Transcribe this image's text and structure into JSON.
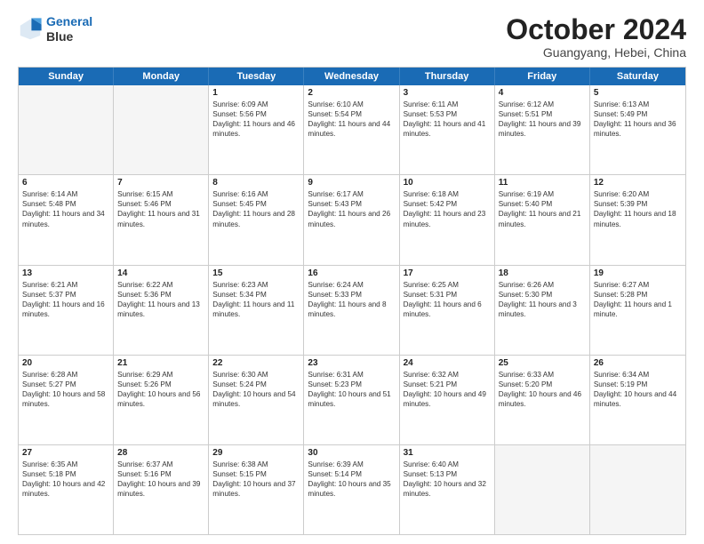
{
  "header": {
    "logo_line1": "General",
    "logo_line2": "Blue",
    "month": "October 2024",
    "location": "Guangyang, Hebei, China"
  },
  "weekdays": [
    "Sunday",
    "Monday",
    "Tuesday",
    "Wednesday",
    "Thursday",
    "Friday",
    "Saturday"
  ],
  "rows": [
    [
      {
        "day": "",
        "sunrise": "",
        "sunset": "",
        "daylight": ""
      },
      {
        "day": "",
        "sunrise": "",
        "sunset": "",
        "daylight": ""
      },
      {
        "day": "1",
        "sunrise": "Sunrise: 6:09 AM",
        "sunset": "Sunset: 5:56 PM",
        "daylight": "Daylight: 11 hours and 46 minutes."
      },
      {
        "day": "2",
        "sunrise": "Sunrise: 6:10 AM",
        "sunset": "Sunset: 5:54 PM",
        "daylight": "Daylight: 11 hours and 44 minutes."
      },
      {
        "day": "3",
        "sunrise": "Sunrise: 6:11 AM",
        "sunset": "Sunset: 5:53 PM",
        "daylight": "Daylight: 11 hours and 41 minutes."
      },
      {
        "day": "4",
        "sunrise": "Sunrise: 6:12 AM",
        "sunset": "Sunset: 5:51 PM",
        "daylight": "Daylight: 11 hours and 39 minutes."
      },
      {
        "day": "5",
        "sunrise": "Sunrise: 6:13 AM",
        "sunset": "Sunset: 5:49 PM",
        "daylight": "Daylight: 11 hours and 36 minutes."
      }
    ],
    [
      {
        "day": "6",
        "sunrise": "Sunrise: 6:14 AM",
        "sunset": "Sunset: 5:48 PM",
        "daylight": "Daylight: 11 hours and 34 minutes."
      },
      {
        "day": "7",
        "sunrise": "Sunrise: 6:15 AM",
        "sunset": "Sunset: 5:46 PM",
        "daylight": "Daylight: 11 hours and 31 minutes."
      },
      {
        "day": "8",
        "sunrise": "Sunrise: 6:16 AM",
        "sunset": "Sunset: 5:45 PM",
        "daylight": "Daylight: 11 hours and 28 minutes."
      },
      {
        "day": "9",
        "sunrise": "Sunrise: 6:17 AM",
        "sunset": "Sunset: 5:43 PM",
        "daylight": "Daylight: 11 hours and 26 minutes."
      },
      {
        "day": "10",
        "sunrise": "Sunrise: 6:18 AM",
        "sunset": "Sunset: 5:42 PM",
        "daylight": "Daylight: 11 hours and 23 minutes."
      },
      {
        "day": "11",
        "sunrise": "Sunrise: 6:19 AM",
        "sunset": "Sunset: 5:40 PM",
        "daylight": "Daylight: 11 hours and 21 minutes."
      },
      {
        "day": "12",
        "sunrise": "Sunrise: 6:20 AM",
        "sunset": "Sunset: 5:39 PM",
        "daylight": "Daylight: 11 hours and 18 minutes."
      }
    ],
    [
      {
        "day": "13",
        "sunrise": "Sunrise: 6:21 AM",
        "sunset": "Sunset: 5:37 PM",
        "daylight": "Daylight: 11 hours and 16 minutes."
      },
      {
        "day": "14",
        "sunrise": "Sunrise: 6:22 AM",
        "sunset": "Sunset: 5:36 PM",
        "daylight": "Daylight: 11 hours and 13 minutes."
      },
      {
        "day": "15",
        "sunrise": "Sunrise: 6:23 AM",
        "sunset": "Sunset: 5:34 PM",
        "daylight": "Daylight: 11 hours and 11 minutes."
      },
      {
        "day": "16",
        "sunrise": "Sunrise: 6:24 AM",
        "sunset": "Sunset: 5:33 PM",
        "daylight": "Daylight: 11 hours and 8 minutes."
      },
      {
        "day": "17",
        "sunrise": "Sunrise: 6:25 AM",
        "sunset": "Sunset: 5:31 PM",
        "daylight": "Daylight: 11 hours and 6 minutes."
      },
      {
        "day": "18",
        "sunrise": "Sunrise: 6:26 AM",
        "sunset": "Sunset: 5:30 PM",
        "daylight": "Daylight: 11 hours and 3 minutes."
      },
      {
        "day": "19",
        "sunrise": "Sunrise: 6:27 AM",
        "sunset": "Sunset: 5:28 PM",
        "daylight": "Daylight: 11 hours and 1 minute."
      }
    ],
    [
      {
        "day": "20",
        "sunrise": "Sunrise: 6:28 AM",
        "sunset": "Sunset: 5:27 PM",
        "daylight": "Daylight: 10 hours and 58 minutes."
      },
      {
        "day": "21",
        "sunrise": "Sunrise: 6:29 AM",
        "sunset": "Sunset: 5:26 PM",
        "daylight": "Daylight: 10 hours and 56 minutes."
      },
      {
        "day": "22",
        "sunrise": "Sunrise: 6:30 AM",
        "sunset": "Sunset: 5:24 PM",
        "daylight": "Daylight: 10 hours and 54 minutes."
      },
      {
        "day": "23",
        "sunrise": "Sunrise: 6:31 AM",
        "sunset": "Sunset: 5:23 PM",
        "daylight": "Daylight: 10 hours and 51 minutes."
      },
      {
        "day": "24",
        "sunrise": "Sunrise: 6:32 AM",
        "sunset": "Sunset: 5:21 PM",
        "daylight": "Daylight: 10 hours and 49 minutes."
      },
      {
        "day": "25",
        "sunrise": "Sunrise: 6:33 AM",
        "sunset": "Sunset: 5:20 PM",
        "daylight": "Daylight: 10 hours and 46 minutes."
      },
      {
        "day": "26",
        "sunrise": "Sunrise: 6:34 AM",
        "sunset": "Sunset: 5:19 PM",
        "daylight": "Daylight: 10 hours and 44 minutes."
      }
    ],
    [
      {
        "day": "27",
        "sunrise": "Sunrise: 6:35 AM",
        "sunset": "Sunset: 5:18 PM",
        "daylight": "Daylight: 10 hours and 42 minutes."
      },
      {
        "day": "28",
        "sunrise": "Sunrise: 6:37 AM",
        "sunset": "Sunset: 5:16 PM",
        "daylight": "Daylight: 10 hours and 39 minutes."
      },
      {
        "day": "29",
        "sunrise": "Sunrise: 6:38 AM",
        "sunset": "Sunset: 5:15 PM",
        "daylight": "Daylight: 10 hours and 37 minutes."
      },
      {
        "day": "30",
        "sunrise": "Sunrise: 6:39 AM",
        "sunset": "Sunset: 5:14 PM",
        "daylight": "Daylight: 10 hours and 35 minutes."
      },
      {
        "day": "31",
        "sunrise": "Sunrise: 6:40 AM",
        "sunset": "Sunset: 5:13 PM",
        "daylight": "Daylight: 10 hours and 32 minutes."
      },
      {
        "day": "",
        "sunrise": "",
        "sunset": "",
        "daylight": ""
      },
      {
        "day": "",
        "sunrise": "",
        "sunset": "",
        "daylight": ""
      }
    ]
  ]
}
